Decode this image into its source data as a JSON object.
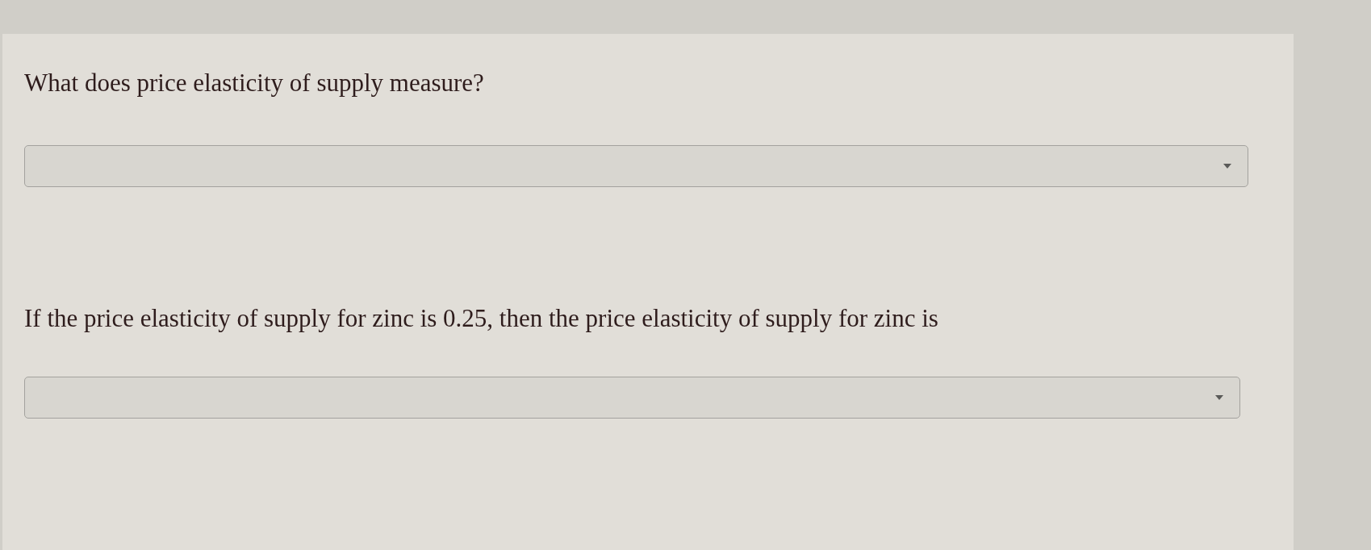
{
  "questions": [
    {
      "prompt": "What does price elasticity of supply measure?"
    },
    {
      "prompt": "If the price elasticity of supply for zinc is 0.25, then the price elasticity of supply for zinc is"
    }
  ]
}
